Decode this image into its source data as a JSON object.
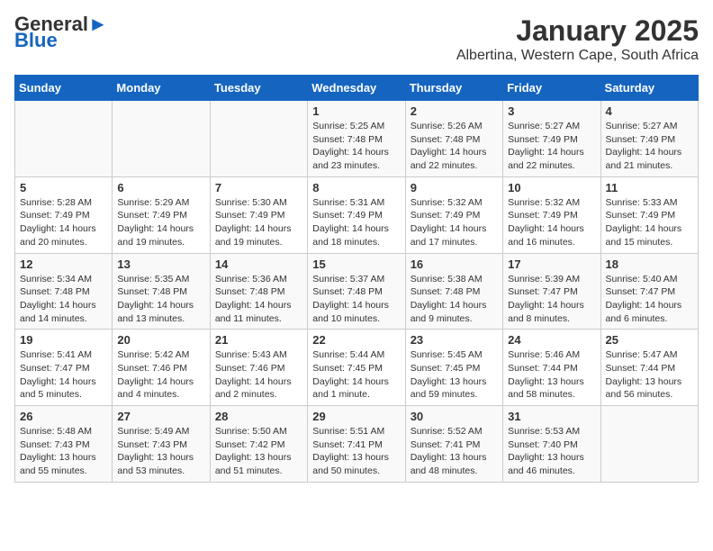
{
  "header": {
    "logo_general": "General",
    "logo_blue": "Blue",
    "month_title": "January 2025",
    "location": "Albertina, Western Cape, South Africa"
  },
  "days_of_week": [
    "Sunday",
    "Monday",
    "Tuesday",
    "Wednesday",
    "Thursday",
    "Friday",
    "Saturday"
  ],
  "weeks": [
    [
      {
        "day": "",
        "info": ""
      },
      {
        "day": "",
        "info": ""
      },
      {
        "day": "",
        "info": ""
      },
      {
        "day": "1",
        "info": "Sunrise: 5:25 AM\nSunset: 7:48 PM\nDaylight: 14 hours\nand 23 minutes."
      },
      {
        "day": "2",
        "info": "Sunrise: 5:26 AM\nSunset: 7:48 PM\nDaylight: 14 hours\nand 22 minutes."
      },
      {
        "day": "3",
        "info": "Sunrise: 5:27 AM\nSunset: 7:49 PM\nDaylight: 14 hours\nand 22 minutes."
      },
      {
        "day": "4",
        "info": "Sunrise: 5:27 AM\nSunset: 7:49 PM\nDaylight: 14 hours\nand 21 minutes."
      }
    ],
    [
      {
        "day": "5",
        "info": "Sunrise: 5:28 AM\nSunset: 7:49 PM\nDaylight: 14 hours\nand 20 minutes."
      },
      {
        "day": "6",
        "info": "Sunrise: 5:29 AM\nSunset: 7:49 PM\nDaylight: 14 hours\nand 19 minutes."
      },
      {
        "day": "7",
        "info": "Sunrise: 5:30 AM\nSunset: 7:49 PM\nDaylight: 14 hours\nand 19 minutes."
      },
      {
        "day": "8",
        "info": "Sunrise: 5:31 AM\nSunset: 7:49 PM\nDaylight: 14 hours\nand 18 minutes."
      },
      {
        "day": "9",
        "info": "Sunrise: 5:32 AM\nSunset: 7:49 PM\nDaylight: 14 hours\nand 17 minutes."
      },
      {
        "day": "10",
        "info": "Sunrise: 5:32 AM\nSunset: 7:49 PM\nDaylight: 14 hours\nand 16 minutes."
      },
      {
        "day": "11",
        "info": "Sunrise: 5:33 AM\nSunset: 7:49 PM\nDaylight: 14 hours\nand 15 minutes."
      }
    ],
    [
      {
        "day": "12",
        "info": "Sunrise: 5:34 AM\nSunset: 7:48 PM\nDaylight: 14 hours\nand 14 minutes."
      },
      {
        "day": "13",
        "info": "Sunrise: 5:35 AM\nSunset: 7:48 PM\nDaylight: 14 hours\nand 13 minutes."
      },
      {
        "day": "14",
        "info": "Sunrise: 5:36 AM\nSunset: 7:48 PM\nDaylight: 14 hours\nand 11 minutes."
      },
      {
        "day": "15",
        "info": "Sunrise: 5:37 AM\nSunset: 7:48 PM\nDaylight: 14 hours\nand 10 minutes."
      },
      {
        "day": "16",
        "info": "Sunrise: 5:38 AM\nSunset: 7:48 PM\nDaylight: 14 hours\nand 9 minutes."
      },
      {
        "day": "17",
        "info": "Sunrise: 5:39 AM\nSunset: 7:47 PM\nDaylight: 14 hours\nand 8 minutes."
      },
      {
        "day": "18",
        "info": "Sunrise: 5:40 AM\nSunset: 7:47 PM\nDaylight: 14 hours\nand 6 minutes."
      }
    ],
    [
      {
        "day": "19",
        "info": "Sunrise: 5:41 AM\nSunset: 7:47 PM\nDaylight: 14 hours\nand 5 minutes."
      },
      {
        "day": "20",
        "info": "Sunrise: 5:42 AM\nSunset: 7:46 PM\nDaylight: 14 hours\nand 4 minutes."
      },
      {
        "day": "21",
        "info": "Sunrise: 5:43 AM\nSunset: 7:46 PM\nDaylight: 14 hours\nand 2 minutes."
      },
      {
        "day": "22",
        "info": "Sunrise: 5:44 AM\nSunset: 7:45 PM\nDaylight: 14 hours\nand 1 minute."
      },
      {
        "day": "23",
        "info": "Sunrise: 5:45 AM\nSunset: 7:45 PM\nDaylight: 13 hours\nand 59 minutes."
      },
      {
        "day": "24",
        "info": "Sunrise: 5:46 AM\nSunset: 7:44 PM\nDaylight: 13 hours\nand 58 minutes."
      },
      {
        "day": "25",
        "info": "Sunrise: 5:47 AM\nSunset: 7:44 PM\nDaylight: 13 hours\nand 56 minutes."
      }
    ],
    [
      {
        "day": "26",
        "info": "Sunrise: 5:48 AM\nSunset: 7:43 PM\nDaylight: 13 hours\nand 55 minutes."
      },
      {
        "day": "27",
        "info": "Sunrise: 5:49 AM\nSunset: 7:43 PM\nDaylight: 13 hours\nand 53 minutes."
      },
      {
        "day": "28",
        "info": "Sunrise: 5:50 AM\nSunset: 7:42 PM\nDaylight: 13 hours\nand 51 minutes."
      },
      {
        "day": "29",
        "info": "Sunrise: 5:51 AM\nSunset: 7:41 PM\nDaylight: 13 hours\nand 50 minutes."
      },
      {
        "day": "30",
        "info": "Sunrise: 5:52 AM\nSunset: 7:41 PM\nDaylight: 13 hours\nand 48 minutes."
      },
      {
        "day": "31",
        "info": "Sunrise: 5:53 AM\nSunset: 7:40 PM\nDaylight: 13 hours\nand 46 minutes."
      },
      {
        "day": "",
        "info": ""
      }
    ]
  ]
}
